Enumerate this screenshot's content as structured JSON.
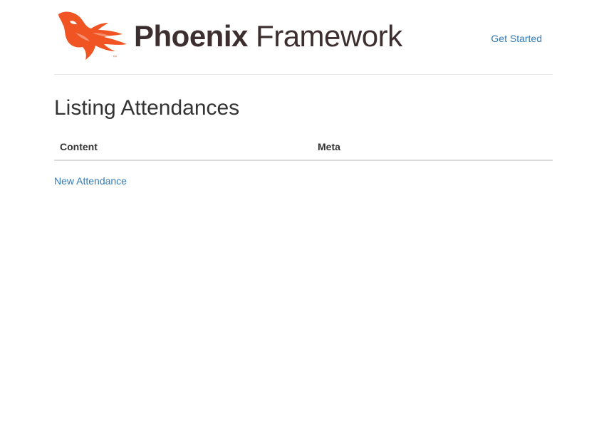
{
  "header": {
    "logo": {
      "icon": "phoenix-bird-logo",
      "name_strong": "Phoenix",
      "name_light": "Framework",
      "brand_color": "#f05423",
      "text_color": "#3d2f2f"
    },
    "nav": {
      "get_started_label": "Get Started"
    }
  },
  "main": {
    "title": "Listing Attendances",
    "table": {
      "columns": [
        "Content",
        "Meta"
      ],
      "rows": []
    },
    "new_link_label": "New Attendance"
  },
  "colors": {
    "link": "#337ab7",
    "divider": "#e5e5e5"
  }
}
